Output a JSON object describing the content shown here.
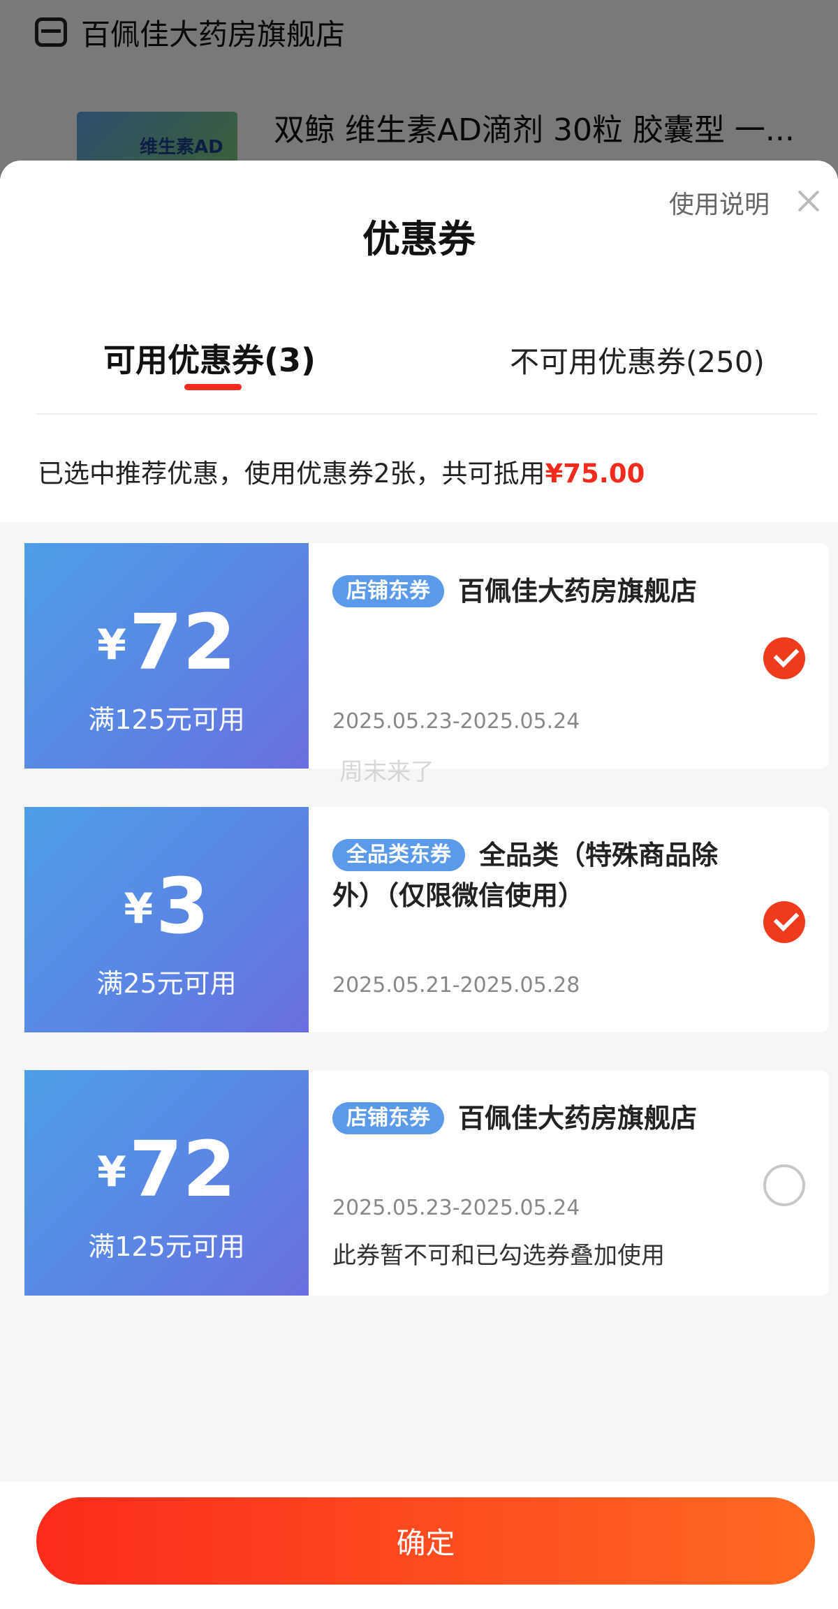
{
  "background": {
    "store_name": "百佩佳大药房旗舰店",
    "product_title": "双鲸 维生素AD滴剂 30粒 胶囊型 一...",
    "product_box_text": "维生素AD滴剂"
  },
  "sheet": {
    "title": "优惠券",
    "usage_link": "使用说明",
    "tabs": [
      {
        "label": "可用优惠券(3)",
        "active": true
      },
      {
        "label": "不可用优惠券(250)",
        "active": false
      }
    ],
    "summary_prefix": "已选中推荐优惠，使用优惠券2张，共可抵用",
    "summary_amount": "¥75.00"
  },
  "coupons": [
    {
      "currency": "¥",
      "amount": "72",
      "condition": "满125元可用",
      "tag": "店铺东券",
      "title": "百佩佳大药房旗舰店",
      "date": "2025.05.23-2025.05.24",
      "note": "",
      "selected": true
    },
    {
      "currency": "¥",
      "amount": "3",
      "condition": "满25元可用",
      "tag": "全品类东券",
      "title": "全品类（特殊商品除外）（仅限微信使用）",
      "date": "2025.05.21-2025.05.28",
      "note": "",
      "selected": true
    },
    {
      "currency": "¥",
      "amount": "72",
      "condition": "满125元可用",
      "tag": "店铺东券",
      "title": "百佩佳大药房旗舰店",
      "date": "2025.05.23-2025.05.24",
      "note": "此券暂不可和已勾选券叠加使用",
      "selected": false
    }
  ],
  "watermark": "周末来了",
  "confirm_label": "确定",
  "colors": {
    "accent": "#f22b1e",
    "coupon_blue": "#5b9ae8",
    "checked": "#f03a1c"
  }
}
